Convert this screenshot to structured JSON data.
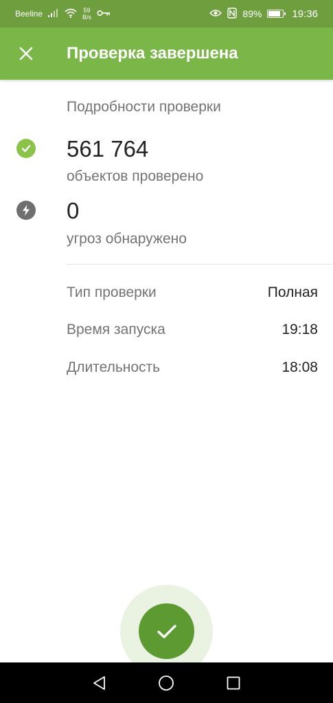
{
  "status_bar": {
    "carrier": "Beeline",
    "net_speed_value": "59",
    "net_speed_unit": "B/s",
    "battery_percent": "89%",
    "time": "19:36"
  },
  "app_bar": {
    "title": "Проверка завершена",
    "close_icon": "close-icon"
  },
  "details": {
    "section_title": "Подробности проверки",
    "scanned": {
      "value": "561 764",
      "label": "объектов проверено",
      "icon": "check-circle-icon",
      "color": "#8bc34a"
    },
    "threats": {
      "value": "0",
      "label": "угроз обнаружено",
      "icon": "lightning-icon",
      "color": "#6f6f6f"
    },
    "rows": [
      {
        "label": "Тип проверки",
        "value": "Полная"
      },
      {
        "label": "Время запуска",
        "value": "19:18"
      },
      {
        "label": "Длительность",
        "value": "18:08"
      }
    ]
  },
  "fab": {
    "icon": "checkmark-icon",
    "color": "#5e9a32"
  },
  "colors": {
    "status_bar": "#6e9e3e",
    "app_bar": "#7ab648",
    "fab_halo": "#eaf3e1"
  }
}
